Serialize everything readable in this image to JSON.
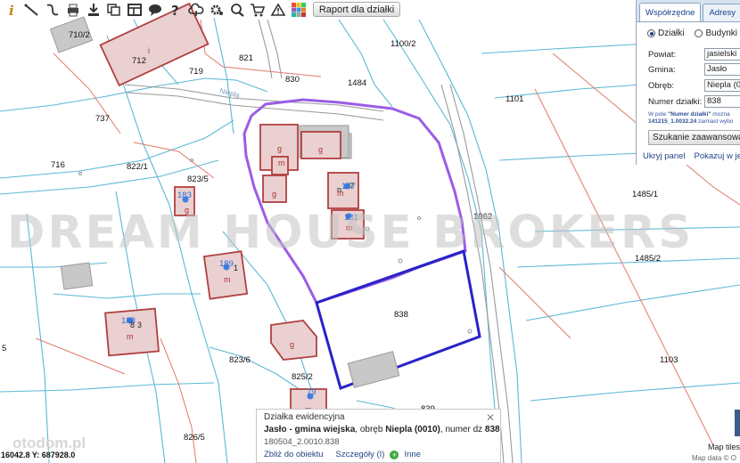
{
  "toolbar": {
    "icons": [
      "info-icon",
      "measure-line-icon",
      "measure-area-icon",
      "print-icon",
      "download-icon",
      "copy-icon",
      "layout-icon",
      "balloon-icon",
      "help-icon",
      "cloud-icon",
      "settings-icon",
      "zoom-icon",
      "cart-icon",
      "warning-icon",
      "layers-icon"
    ],
    "report_button": "Raport dla działki"
  },
  "panel": {
    "tabs": [
      "Współrzędne",
      "Adresy"
    ],
    "radio": [
      {
        "label": "Działki",
        "selected": true
      },
      {
        "label": "Budynki",
        "selected": false
      }
    ],
    "fields": [
      {
        "label": "Powiat:",
        "value": "jasielski"
      },
      {
        "label": "Gmina:",
        "value": "Jasło"
      },
      {
        "label": "Obręb:",
        "value": "Niepla (0"
      },
      {
        "label": "Numer działki:",
        "value": "838"
      }
    ],
    "hint_part1": "W pole ",
    "hint_bold1": "\"Numer działki\"",
    "hint_part2": " można",
    "hint_bold2": "141215_1.0032.24",
    "hint_part3": " zamiast wybo",
    "advanced_button": "Szukanie zaawansowane",
    "link_hide": "Ukryj panel",
    "link_show": "Pokazuj w jedny"
  },
  "map": {
    "parcel_numbers": [
      "710/2",
      "712",
      "719",
      "821",
      "1100/2",
      "830",
      "1484",
      "1101",
      "737",
      "716",
      "822/1",
      "823/5",
      "1485/1",
      "1062",
      "1485/2",
      "838",
      "823/6",
      "825/2",
      "1103",
      "826/5",
      "839",
      "5"
    ],
    "building_labels": [
      "g",
      "g",
      "g",
      "g",
      "m",
      "m",
      "m",
      "m",
      "m",
      "g",
      "m",
      "i"
    ],
    "address_numbers": [
      "183",
      "188",
      "189",
      "181",
      "187",
      "79"
    ],
    "address_suffixes": [
      "8",
      "3",
      "1",
      "n",
      "7"
    ],
    "street": "Niepla",
    "colors": {
      "highlight_parcel": "#2a22c8",
      "boundary": "#9b5de5",
      "building": "#b04040",
      "lines_cyan": "#5bb8d6",
      "lines_red": "#e07a6a"
    }
  },
  "watermark": "DREAM HOUSE BROKERS",
  "popup": {
    "title": "Działka ewidencyjna",
    "desc_bold1": "Jasło - gmina wiejska",
    "desc_mid": ", obręb ",
    "desc_bold2": "Niepla (0010)",
    "desc_tail": ", numer dz ",
    "desc_bold3": "838",
    "id": "180504_2.0010.838",
    "link_zoom": "Zbliż do obiektu",
    "link_details": "Szczegóły (I)",
    "link_other": "Inne",
    "close_icon": "close-icon"
  },
  "coords": "16042.8  Y: 687928.0",
  "logo_text": "otodom.pl",
  "attribution": {
    "line1": "Map tiles",
    "line2": "Map data © O"
  }
}
